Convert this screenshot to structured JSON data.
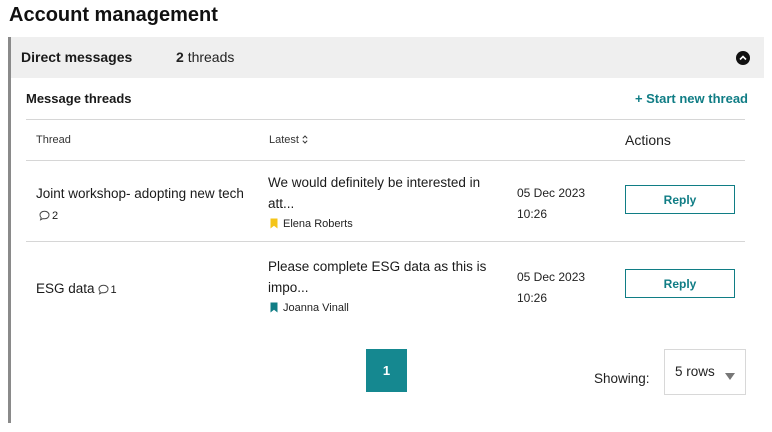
{
  "page": {
    "title": "Account management"
  },
  "panel": {
    "title": "Direct messages",
    "thread_count": "2",
    "thread_count_suffix": "threads",
    "collapse_icon": "chevron-up-circle-icon"
  },
  "card": {
    "title": "Message threads",
    "start_thread_label": "+ Start new thread"
  },
  "table": {
    "headers": {
      "thread": "Thread",
      "latest": "Latest",
      "actions": "Actions"
    },
    "rows": [
      {
        "thread": "Joint workshop- adopting new tech",
        "comments": "2",
        "latest": "We would definitely be interested in att...",
        "author": "Elena Roberts",
        "bookmark_color": "#f5c518",
        "date": "05 Dec 2023",
        "time": "10:26",
        "action": "Reply"
      },
      {
        "thread": "ESG data",
        "comments": "1",
        "latest": "Please complete ESG data as this is impo...",
        "author": "Joanna Vinall",
        "bookmark_color": "#107d85",
        "date": "05 Dec 2023",
        "time": "10:26",
        "action": "Reply"
      }
    ]
  },
  "pagination": {
    "current_page": "1"
  },
  "showing": {
    "label": "Showing:",
    "value": "5 rows"
  },
  "colors": {
    "accent": "#107d85",
    "page_button": "#158890"
  }
}
